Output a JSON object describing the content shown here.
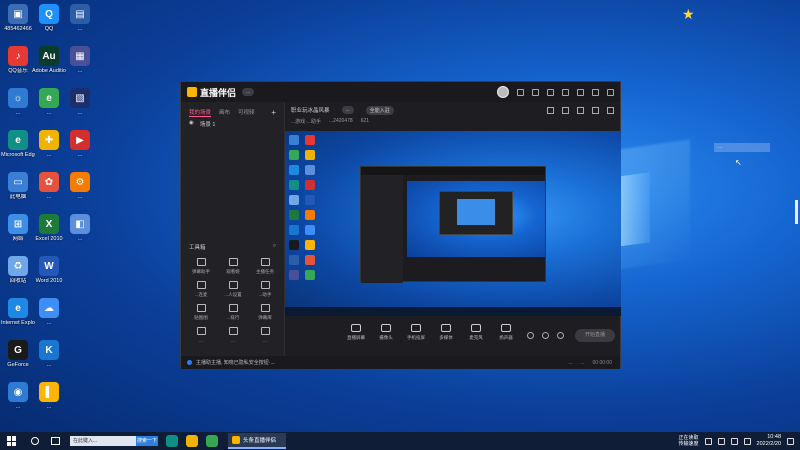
{
  "desktop": {
    "icons": [
      {
        "label": "485462466",
        "color": "#3a6db5",
        "glyph": "▣"
      },
      {
        "label": "QQ",
        "color": "#1e90ff",
        "glyph": "Q"
      },
      {
        "label": "...",
        "color": "#2c5ea8",
        "glyph": "▤"
      },
      {
        "label": "QQ音乐",
        "color": "#e53935",
        "glyph": "♪"
      },
      {
        "label": "Adobe Audition",
        "color": "#0a3b2d",
        "glyph": "Au"
      },
      {
        "label": "...",
        "color": "#4a4f9a",
        "glyph": "▦"
      },
      {
        "label": "...",
        "color": "#2f7bd4",
        "glyph": "☼"
      },
      {
        "label": "...",
        "color": "#34a853",
        "glyph": "e"
      },
      {
        "label": "...",
        "color": "#1d2f6b",
        "glyph": "▧"
      },
      {
        "label": "Microsoft Edge",
        "color": "#0f8f85",
        "glyph": "e"
      },
      {
        "label": "...",
        "color": "#f0b400",
        "glyph": "✚"
      },
      {
        "label": "...",
        "color": "#d32f2f",
        "glyph": "▶"
      },
      {
        "label": "此电脑",
        "color": "#3a7fd5",
        "glyph": "▭"
      },
      {
        "label": "...",
        "color": "#e5533c",
        "glyph": "✿"
      },
      {
        "label": "...",
        "color": "#f57c00",
        "glyph": "⚙"
      },
      {
        "label": "网络",
        "color": "#3d8ee6",
        "glyph": "⊞"
      },
      {
        "label": "Excel 2010",
        "color": "#1d7a3a",
        "glyph": "X"
      },
      {
        "label": "...",
        "color": "#5b8fdc",
        "glyph": "◧"
      },
      {
        "label": "回收站",
        "color": "#6fa7e8",
        "glyph": "♻"
      },
      {
        "label": "Word 2010",
        "color": "#2458b8",
        "glyph": "W"
      },
      {
        "label": "",
        "color": "transparent",
        "glyph": ""
      },
      {
        "label": "Internet Explorer",
        "color": "#1e88e5",
        "glyph": "e"
      },
      {
        "label": "...",
        "color": "#3e8ef7",
        "glyph": "☁"
      },
      {
        "label": "",
        "color": "transparent",
        "glyph": ""
      },
      {
        "label": "GeForce",
        "color": "#1a1a1a",
        "glyph": "G"
      },
      {
        "label": "...",
        "color": "#1976d2",
        "glyph": "K"
      },
      {
        "label": "",
        "color": "transparent",
        "glyph": ""
      },
      {
        "label": "...",
        "color": "#2f7bd4",
        "glyph": "◉"
      },
      {
        "label": "...",
        "color": "#ffb400",
        "glyph": "▌"
      }
    ],
    "tooltip": "...",
    "cursor": "↖"
  },
  "app": {
    "title": "直播伴侣",
    "badge": "...",
    "tabs": [
      "我的场景",
      "画布",
      "可视频"
    ],
    "scene_name": "场景 1",
    "tools_title": "工具箱",
    "tools": [
      {
        "label": "弹幕助手"
      },
      {
        "label": "观看姬"
      },
      {
        "label": "主播任务"
      },
      {
        "label": "...连麦"
      },
      {
        "label": "...人设置"
      },
      {
        "label": "...助手"
      },
      {
        "label": "贴图图"
      },
      {
        "label": "...排行"
      },
      {
        "label": "弹幕库"
      },
      {
        "label": "..."
      },
      {
        "label": "..."
      },
      {
        "label": "..."
      }
    ],
    "room_title": "职业玩冰晶风暴",
    "room_tag": "...",
    "room_btn": "全能入驻",
    "room_meta": [
      "...游戏·...助手",
      "...2420478",
      "621"
    ],
    "controls": [
      {
        "label": "直播屏幕"
      },
      {
        "label": "摄像头"
      },
      {
        "label": "手机投屏"
      },
      {
        "label": "多媒体"
      },
      {
        "label": "麦克风"
      },
      {
        "label": "扬声器"
      }
    ],
    "go_live": "开始直播",
    "status_text": "主播助主播, 知晓已隐私安全按钮·...",
    "status_right": [
      "...",
      "...",
      "00:00:00"
    ]
  },
  "taskbar": {
    "search_placeholder": "在此键入...",
    "search_btn": "搜索一下",
    "active_app": "头条直播伴侣",
    "tray_text": "正在读取\n传输速度",
    "time": "10:48",
    "date": "2022/2/20"
  }
}
